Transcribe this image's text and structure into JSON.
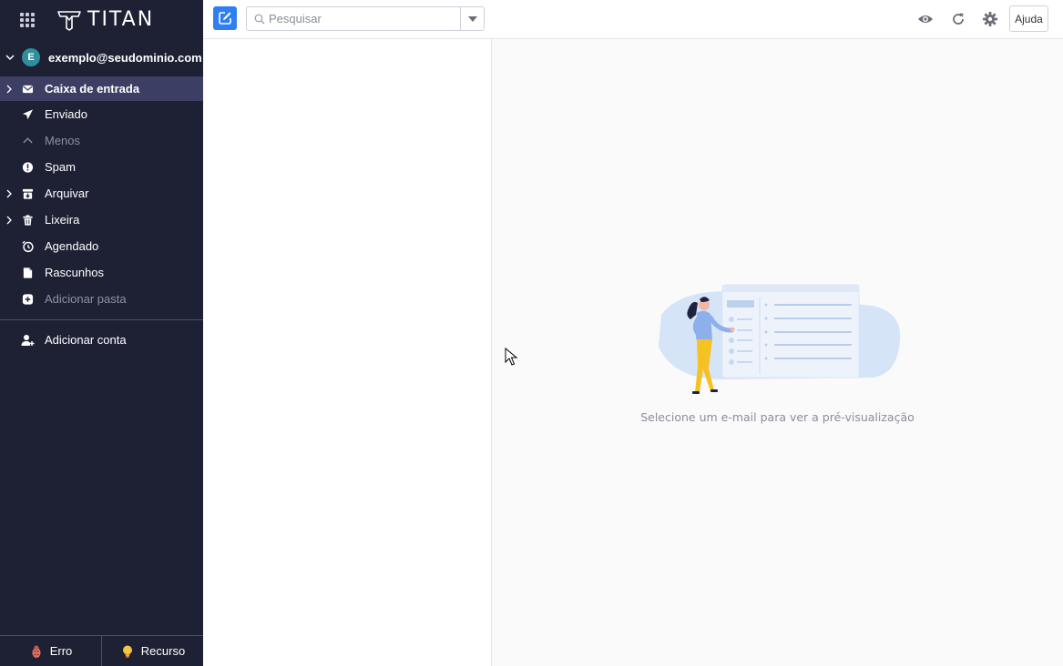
{
  "brand": {
    "logo_text": "TITAN",
    "apps_icon": "grid-icon"
  },
  "account": {
    "avatar_letter": "E",
    "email": "exemplo@seudominio.com",
    "avatar_color": "#2f8f9d"
  },
  "folders": [
    {
      "label": "Caixa de entrada",
      "icon": "envelope-icon",
      "active": true,
      "expandable": true
    },
    {
      "label": "Enviado",
      "icon": "paper-plane-icon"
    },
    {
      "label": "Menos",
      "icon": "chevron-up-icon",
      "muted": true
    },
    {
      "label": "Spam",
      "icon": "alert-icon"
    },
    {
      "label": "Arquivar",
      "icon": "archive-icon",
      "expandable": true
    },
    {
      "label": "Lixeira",
      "icon": "trash-icon",
      "expandable": true
    },
    {
      "label": "Agendado",
      "icon": "clock-icon"
    },
    {
      "label": "Rascunhos",
      "icon": "draft-icon"
    },
    {
      "label": "Adicionar pasta",
      "icon": "plus-square-icon",
      "muted": true
    }
  ],
  "add_account": {
    "label": "Adicionar conta",
    "icon": "add-user-icon"
  },
  "footer": {
    "bug_label": "Erro",
    "feature_label": "Recurso"
  },
  "search": {
    "placeholder": "Pesquisar"
  },
  "toolbar": {
    "help_label": "Ajuda"
  },
  "preview": {
    "empty_text": "Selecione um e-mail para ver a pré-visualização"
  },
  "colors": {
    "sidebar_bg": "#1e2134",
    "active_folder": "#3c3f63",
    "accent": "#2f7ff0"
  }
}
